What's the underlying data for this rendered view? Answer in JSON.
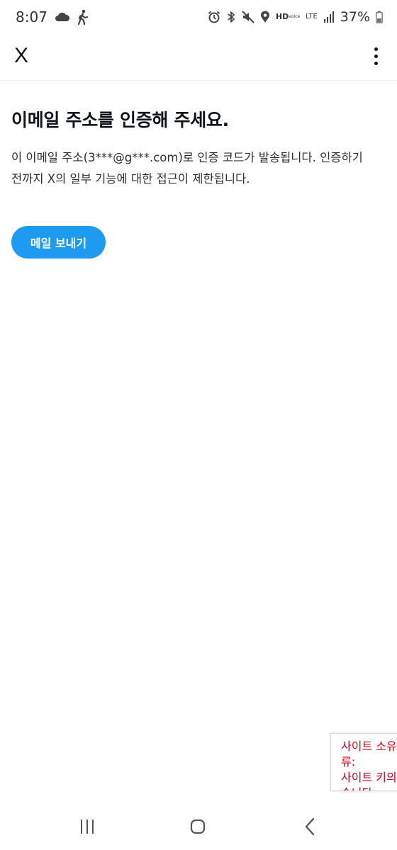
{
  "status_bar": {
    "time": "8:07",
    "hd_label": "HD",
    "hd_sub": "voice",
    "lte_label": "LTE",
    "battery_percent": "37%",
    "icons": [
      "cloud-icon",
      "walking-icon",
      "alarm-icon",
      "bluetooth-icon",
      "mute-icon",
      "location-icon",
      "hd-voice-icon",
      "lte-icon",
      "signal-icon",
      "battery-icon"
    ]
  },
  "app_bar": {
    "logo": "X",
    "more_icon": "more-vertical-icon"
  },
  "main": {
    "title": "이메일 주소를 인증해 주세요.",
    "description_line1": "이 이메일 주소(3***@g***.com)로 인증 코드가 발송됩니다. 인증하기",
    "description_line2": "전까지 X의 일부 기능에 대한 접근이 제한됩니다.",
    "send_button": "메일 보내기"
  },
  "toast": {
    "line1": "사이트 소유",
    "line2": "류:",
    "line3": "사이트 키의",
    "line4": "습니다"
  },
  "nav_bar": {
    "icons": [
      "recents-icon",
      "home-icon",
      "back-icon"
    ]
  },
  "colors": {
    "accent": "#1d9bf0",
    "error": "#d0021b",
    "text": "#0f1419"
  }
}
